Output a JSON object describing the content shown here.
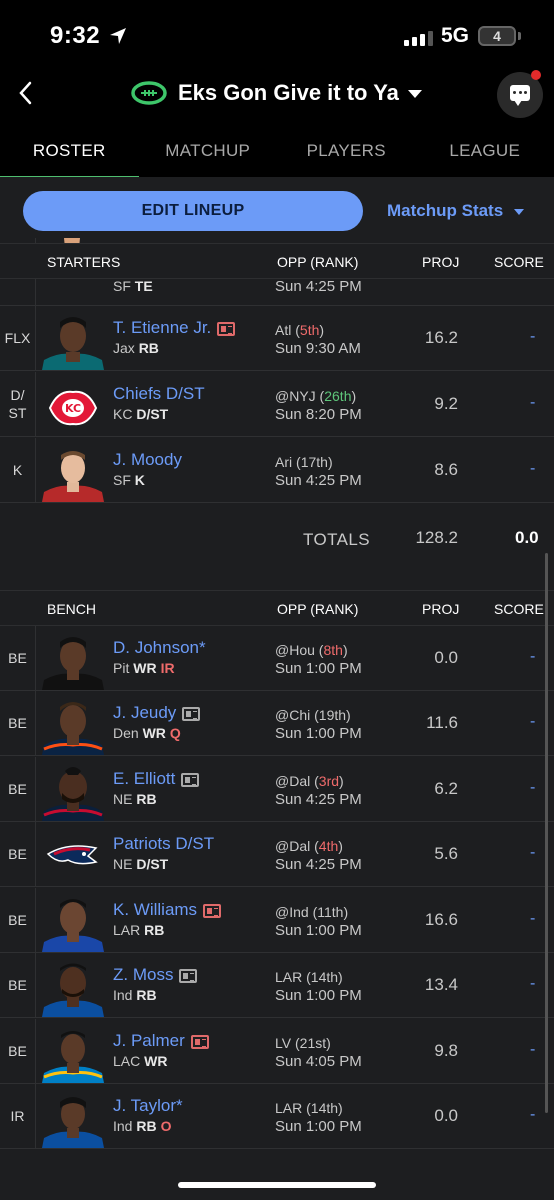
{
  "status_bar": {
    "time": "9:32",
    "network": "5G",
    "battery": "4"
  },
  "header": {
    "team_name": "Eks Gon Give it to Ya"
  },
  "tabs": [
    {
      "label": "ROSTER"
    },
    {
      "label": "MATCHUP"
    },
    {
      "label": "PLAYERS"
    },
    {
      "label": "LEAGUE"
    }
  ],
  "actions": {
    "edit_lineup": "EDIT LINEUP",
    "matchup_stats": "Matchup Stats"
  },
  "starters_header": {
    "label": "STARTERS",
    "opp": "OPP (RANK)",
    "proj": "PROJ",
    "score": "SCORE"
  },
  "partial_row": {
    "team": "SF",
    "pos": "TE",
    "time": "Sun 4:25 PM"
  },
  "starters": [
    {
      "slot": "FLX",
      "name": "T. Etienne Jr.",
      "team": "Jax",
      "pos": "RB",
      "opp": "Atl",
      "rank": "5th",
      "time": "Sun 9:30 AM",
      "proj": "16.2",
      "score": "-"
    },
    {
      "slot": "D/ST",
      "name": "Chiefs D/ST",
      "team": "KC",
      "pos": "D/ST",
      "opp": "@NYJ",
      "rank": "26th",
      "time": "Sun 8:20 PM",
      "proj": "9.2",
      "score": "-"
    },
    {
      "slot": "K",
      "name": "J. Moody",
      "team": "SF",
      "pos": "K",
      "opp": "Ari",
      "rank": "17th",
      "time": "Sun 4:25 PM",
      "proj": "8.6",
      "score": "-"
    }
  ],
  "totals": {
    "label": "TOTALS",
    "proj": "128.2",
    "score": "0.0"
  },
  "bench_header": {
    "label": "BENCH",
    "opp": "OPP (RANK)",
    "proj": "PROJ",
    "score": "SCORE"
  },
  "bench": [
    {
      "slot": "BE",
      "name": "D. Johnson*",
      "team": "Pit",
      "pos": "WR",
      "status": "IR",
      "opp": "@Hou",
      "rank": "8th",
      "time": "Sun 1:00 PM",
      "proj": "0.0",
      "score": "-"
    },
    {
      "slot": "BE",
      "name": "J. Jeudy",
      "team": "Den",
      "pos": "WR",
      "status": "Q",
      "opp": "@Chi",
      "rank": "19th",
      "time": "Sun 1:00 PM",
      "proj": "11.6",
      "score": "-"
    },
    {
      "slot": "BE",
      "name": "E. Elliott",
      "team": "NE",
      "pos": "RB",
      "status": "",
      "opp": "@Dal",
      "rank": "3rd",
      "time": "Sun 4:25 PM",
      "proj": "6.2",
      "score": "-"
    },
    {
      "slot": "BE",
      "name": "Patriots D/ST",
      "team": "NE",
      "pos": "D/ST",
      "status": "",
      "opp": "@Dal",
      "rank": "4th",
      "time": "Sun 4:25 PM",
      "proj": "5.6",
      "score": "-"
    },
    {
      "slot": "BE",
      "name": "K. Williams",
      "team": "LAR",
      "pos": "RB",
      "status": "",
      "opp": "@Ind",
      "rank": "11th",
      "time": "Sun 1:00 PM",
      "proj": "16.6",
      "score": "-"
    },
    {
      "slot": "BE",
      "name": "Z. Moss",
      "team": "Ind",
      "pos": "RB",
      "status": "",
      "opp": "LAR",
      "rank": "14th",
      "time": "Sun 1:00 PM",
      "proj": "13.4",
      "score": "-"
    },
    {
      "slot": "BE",
      "name": "J. Palmer",
      "team": "LAC",
      "pos": "WR",
      "status": "",
      "opp": "LV",
      "rank": "21st",
      "time": "Sun 4:05 PM",
      "proj": "9.8",
      "score": "-"
    },
    {
      "slot": "IR",
      "name": "J. Taylor*",
      "team": "Ind",
      "pos": "RB",
      "status": "O",
      "opp": "LAR",
      "rank": "14th",
      "time": "Sun 1:00 PM",
      "proj": "0.0",
      "score": "-"
    }
  ],
  "colors": {
    "accent_blue": "#6c9bf7",
    "tab_underline": "#4fbf6f",
    "bad_matchup": "#ef6b6b",
    "good_matchup": "#5ec67a"
  }
}
